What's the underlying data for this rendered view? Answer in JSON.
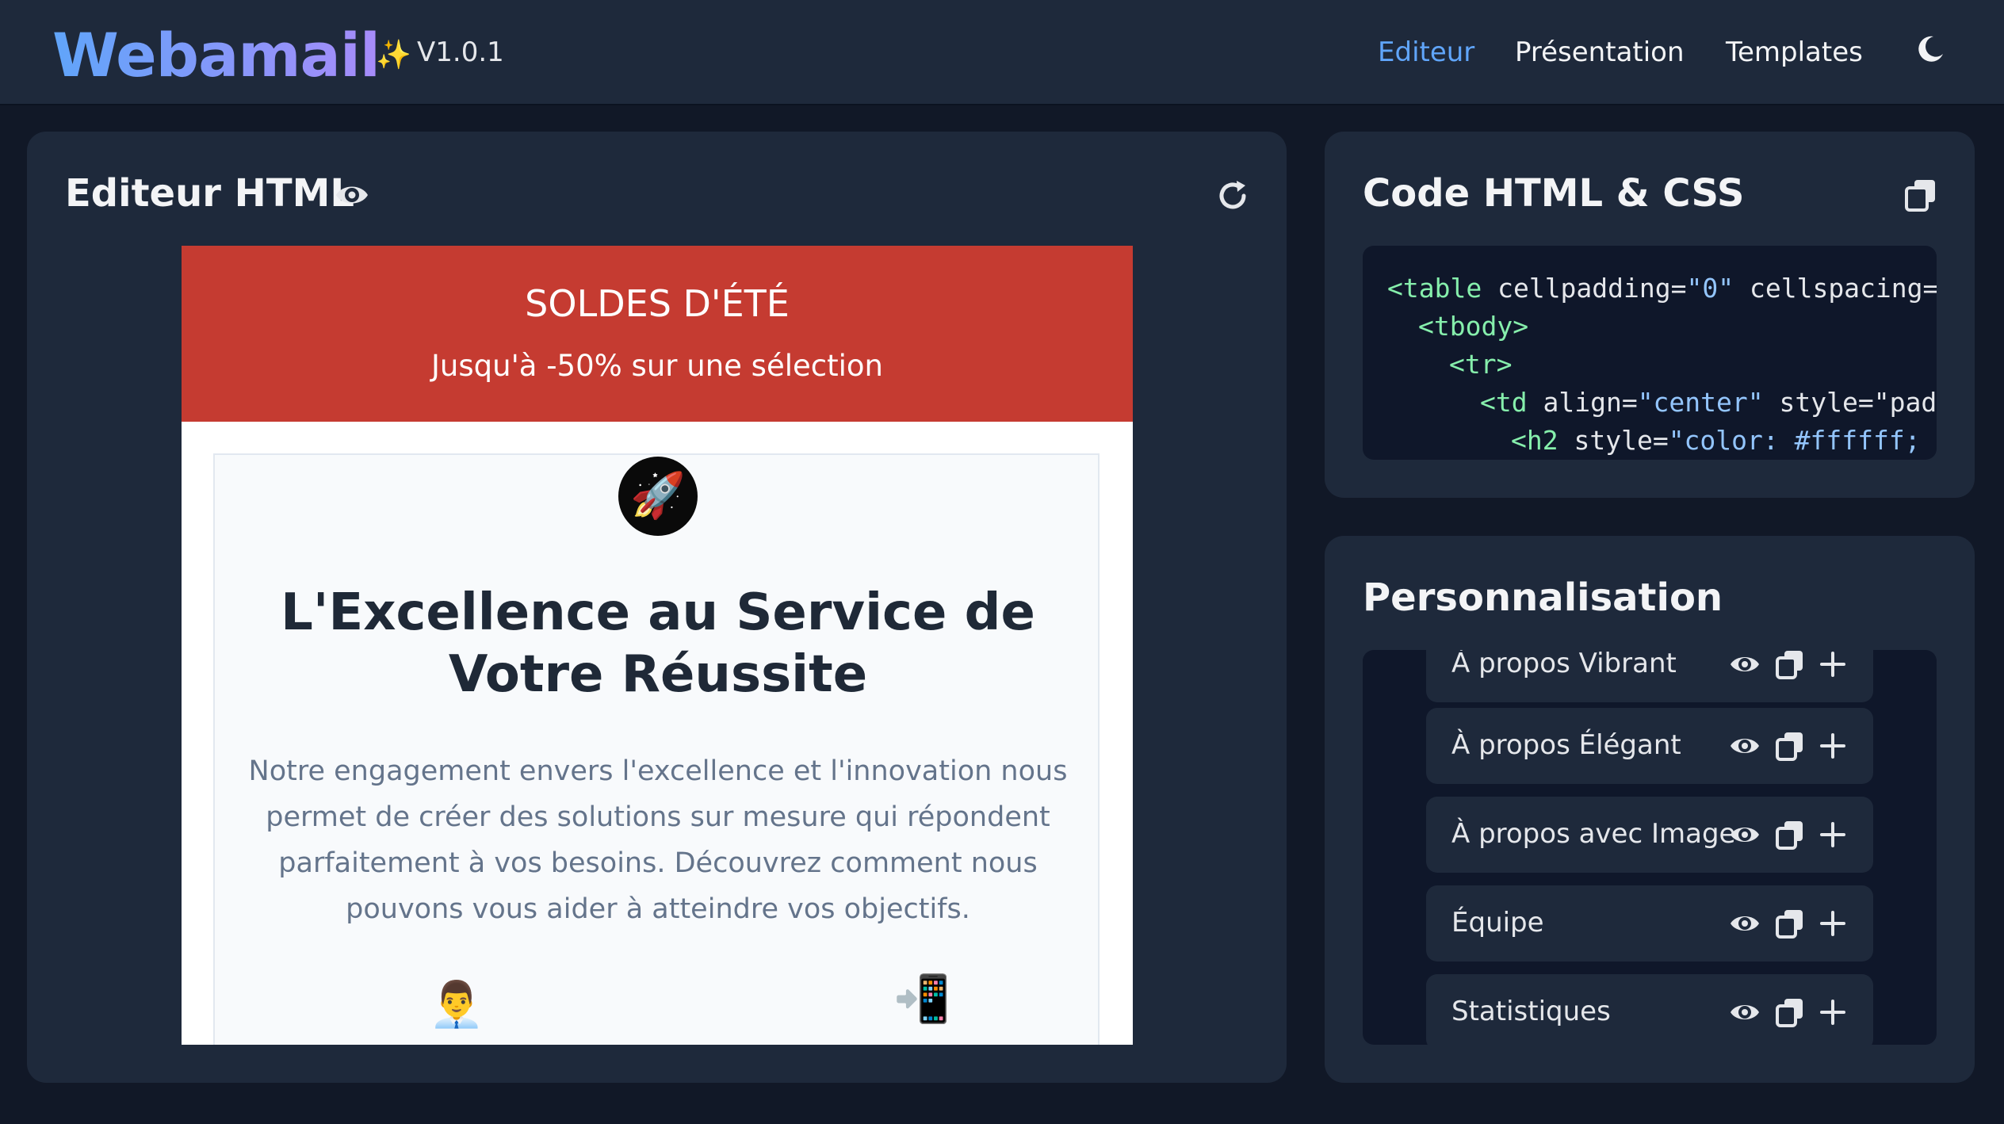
{
  "header": {
    "logo": "Webamail",
    "sparkle": "✨",
    "version": "V1.0.1",
    "nav": [
      "Editeur",
      "Présentation",
      "Templates"
    ],
    "active_nav": "Editeur",
    "accent_color": "#60a5fa"
  },
  "editor": {
    "title": "Editeur HTML",
    "email": {
      "banner_title": "SOLDES D'ÉTÉ",
      "banner_subtitle": "Jusqu'à -50% sur une sélection",
      "banner_color": "#c53b31",
      "icon": "🚀",
      "headline": "L'Excellence au Service de Votre Réussite",
      "paragraph": "Notre engagement envers l'excellence et l'innovation nous permet de créer des solutions sur mesure qui répondent parfaitement à vos besoins. Découvrez comment nous pouvons vous aider à atteindre vos objectifs.",
      "feature_icons": [
        "👨‍💼",
        "📲"
      ]
    }
  },
  "code_panel": {
    "title": "Code HTML & CSS",
    "lines": [
      {
        "tag": "<table",
        "attrs": " cellpadding=",
        "val": "\"0\"",
        "rest": " cellspacing=\""
      },
      {
        "tag": "<tbody>",
        "attrs": "",
        "val": "",
        "rest": ""
      },
      {
        "tag": "<tr>",
        "attrs": "",
        "val": "",
        "rest": ""
      },
      {
        "tag": "<td",
        "attrs": " align=",
        "val": "\"center\"",
        "rest": " style=\"padd"
      },
      {
        "tag": "<h2",
        "attrs": " style=",
        "val": "\"color: #ffffff; m",
        "rest": ""
      }
    ]
  },
  "customization": {
    "title": "Personnalisation",
    "items": [
      {
        "label": "À propos Vibrant"
      },
      {
        "label": "À propos Élégant"
      },
      {
        "label": "À propos avec Image"
      },
      {
        "label": "Équipe"
      },
      {
        "label": "Statistiques"
      }
    ]
  }
}
